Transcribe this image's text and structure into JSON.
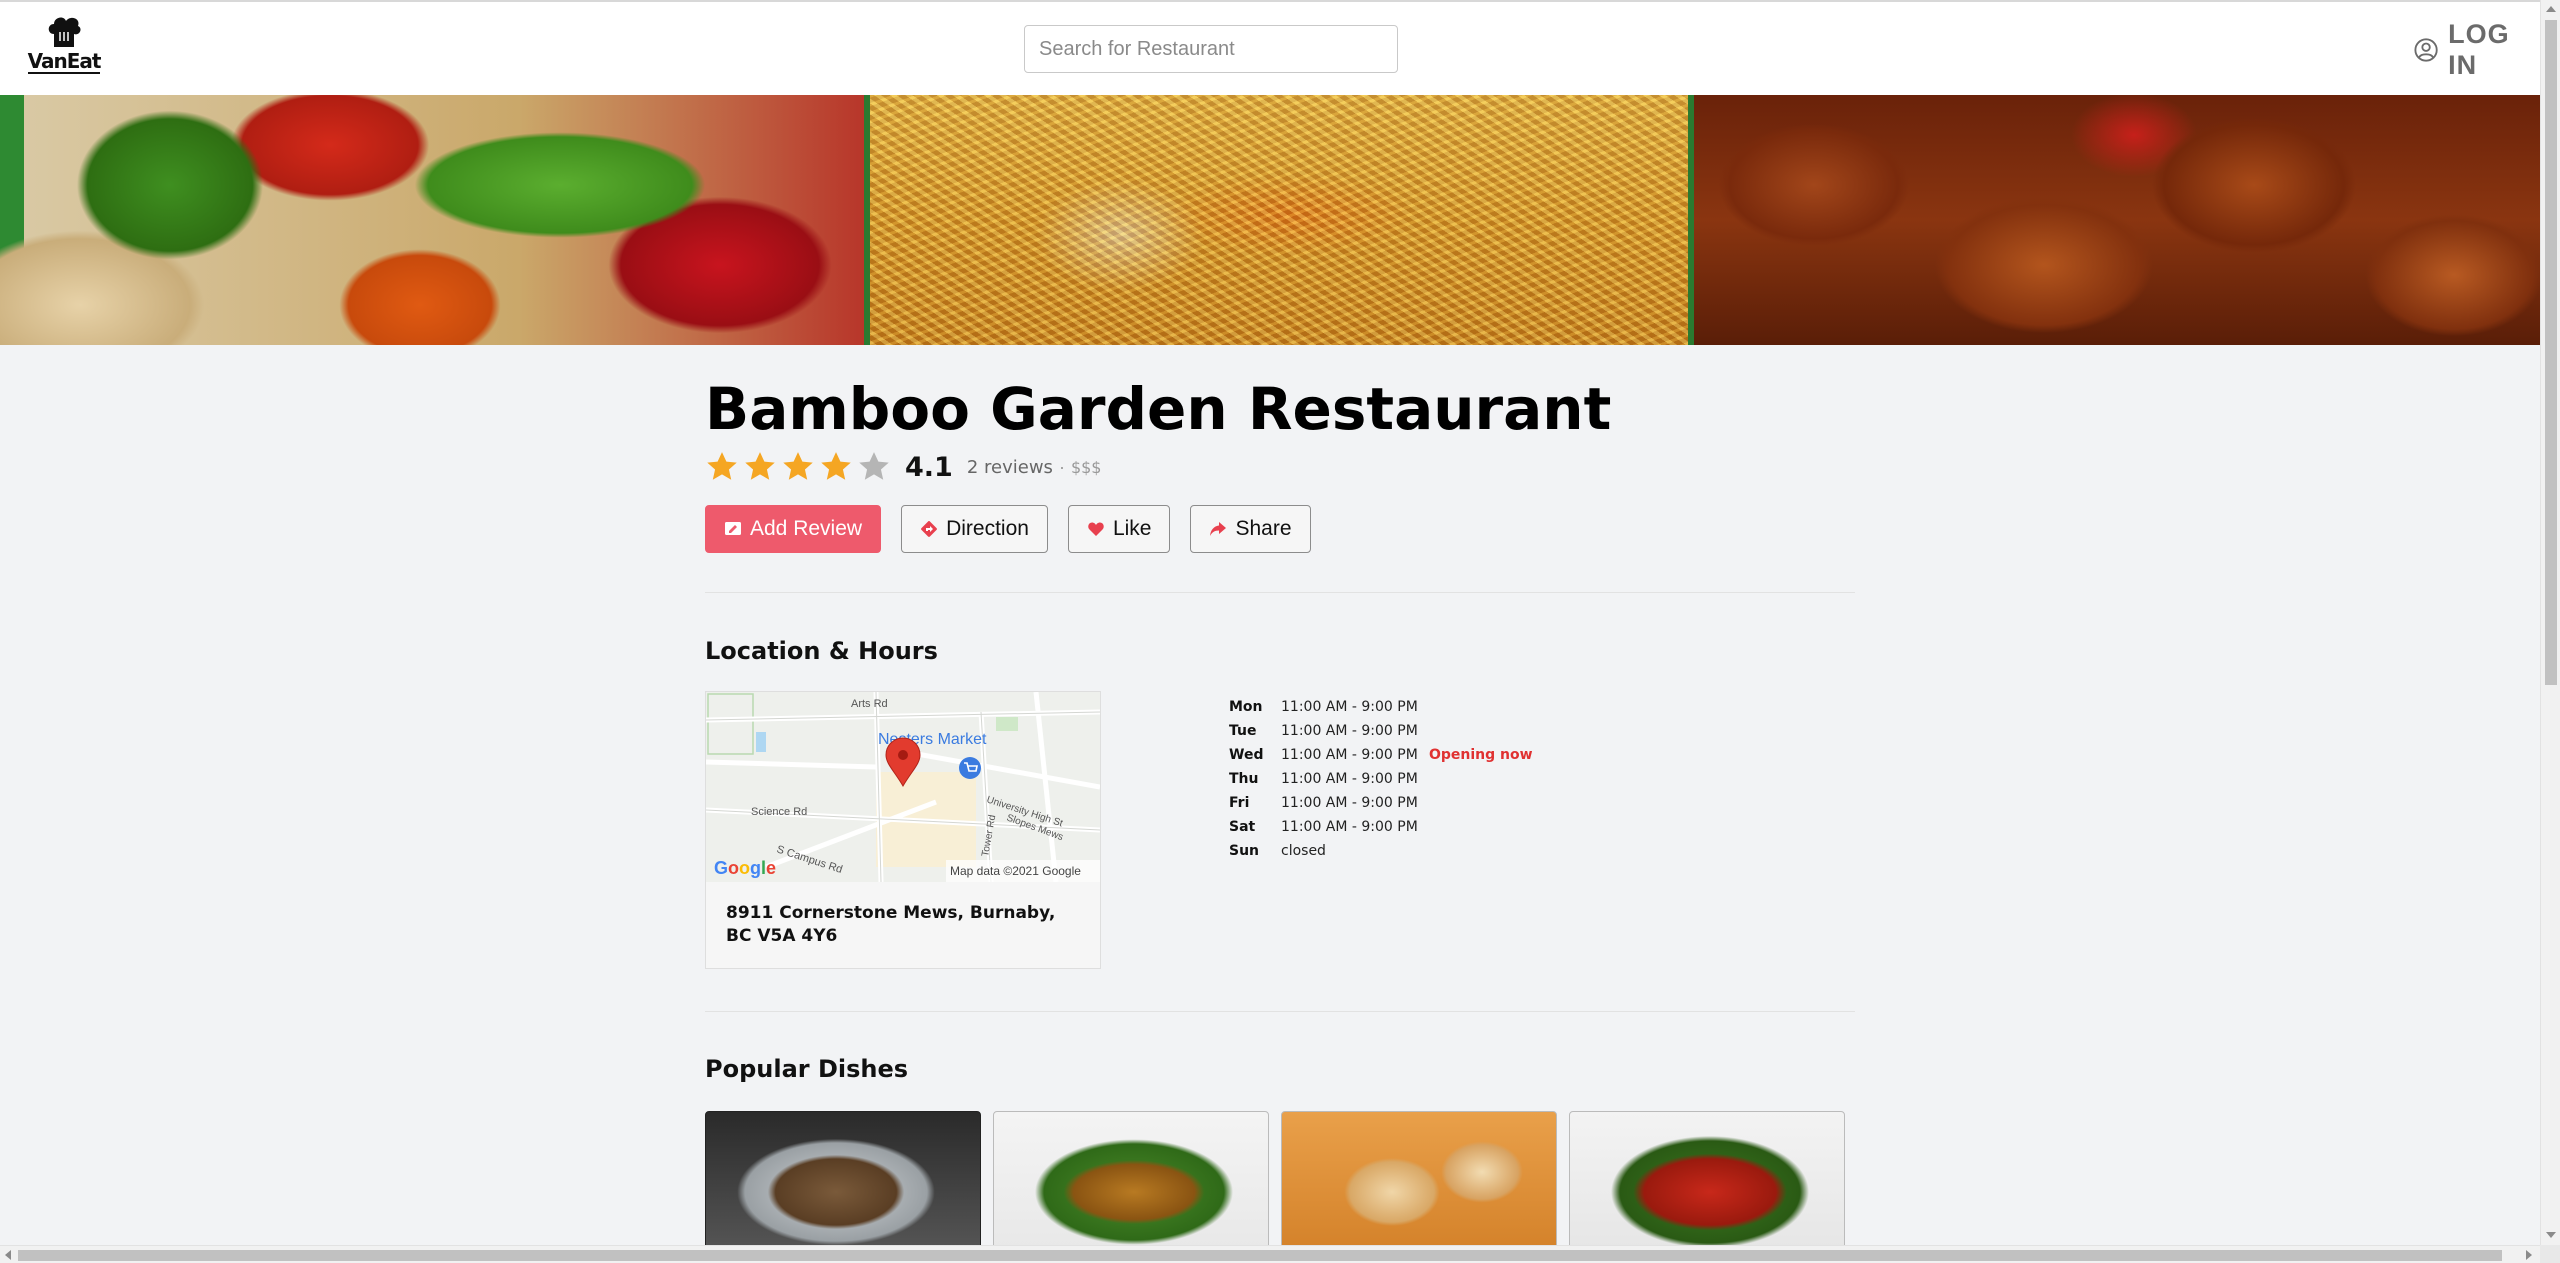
{
  "header": {
    "logo_text": "VanEat",
    "search_placeholder": "Search for Restaurant",
    "login_label": "LOG IN",
    "icons": {
      "logo": "chef-hat-icon",
      "login": "user-circle-icon"
    }
  },
  "banner": {
    "images": [
      "stir-fry-vegetables",
      "chow-mein-noodles",
      "orange-chicken"
    ]
  },
  "restaurant": {
    "name": "Bamboo Garden Restaurant",
    "rating": 4.1,
    "rating_display": "4.1",
    "stars_filled": 4,
    "stars_total": 5,
    "reviews": "2 reviews",
    "separator": "·",
    "price": "$$$"
  },
  "actions": {
    "add_review": "Add Review",
    "direction": "Direction",
    "like": "Like",
    "share": "Share"
  },
  "location": {
    "section_title": "Location & Hours",
    "address": "8911 Cornerstone Mews, Burnaby, BC V5A 4Y6",
    "map": {
      "place_label": "Nesters Market",
      "roads": [
        "Arts Rd",
        "Science Rd",
        "S Campus Rd",
        "University High St",
        "Slopes Mews",
        "Tower Rd"
      ],
      "attribution": "Map data ©2021 Google",
      "provider": "Google"
    },
    "hours": [
      {
        "day": "Mon",
        "time": "11:00 AM - 9:00 PM",
        "status": ""
      },
      {
        "day": "Tue",
        "time": "11:00 AM - 9:00 PM",
        "status": ""
      },
      {
        "day": "Wed",
        "time": "11:00 AM - 9:00 PM",
        "status": "Opening now"
      },
      {
        "day": "Thu",
        "time": "11:00 AM - 9:00 PM",
        "status": ""
      },
      {
        "day": "Fri",
        "time": "11:00 AM - 9:00 PM",
        "status": ""
      },
      {
        "day": "Sat",
        "time": "11:00 AM - 9:00 PM",
        "status": ""
      },
      {
        "day": "Sun",
        "time": "closed",
        "status": ""
      }
    ]
  },
  "dishes": {
    "section_title": "Popular Dishes",
    "items": [
      "dish-1",
      "dish-2",
      "dish-3",
      "dish-4"
    ]
  },
  "colors": {
    "primary": "#ee5a6c",
    "star": "#f5a623",
    "star_empty": "#b5b5b5",
    "open_status": "#e03131",
    "background": "#f2f3f5"
  }
}
